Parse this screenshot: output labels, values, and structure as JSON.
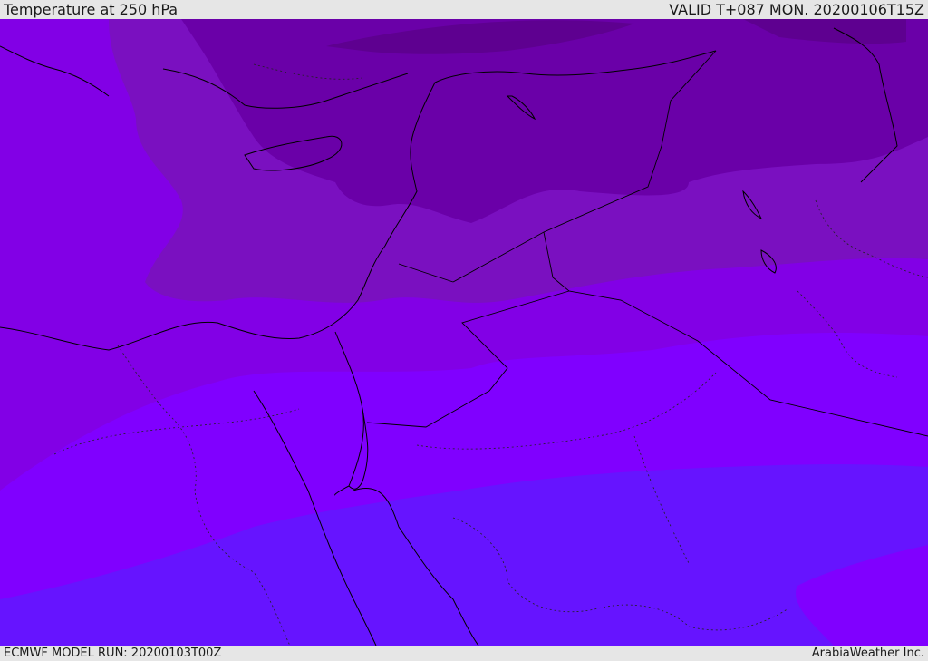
{
  "header": {
    "title": "Temperature at 250 hPa",
    "valid": "VALID T+087 MON. 20200106T15Z"
  },
  "footer": {
    "model_run": "ECMWF MODEL RUN: 20200103T00Z",
    "credit": "ArabiaWeather Inc."
  },
  "colors": {
    "band_darkest": "#5e0090",
    "band_dark": "#6a00a8",
    "band_mid": "#7a10c0",
    "band_violet": "#8200e6",
    "band_bright": "#8000ff",
    "band_blue": "#6614ff",
    "coast": "#000000"
  }
}
